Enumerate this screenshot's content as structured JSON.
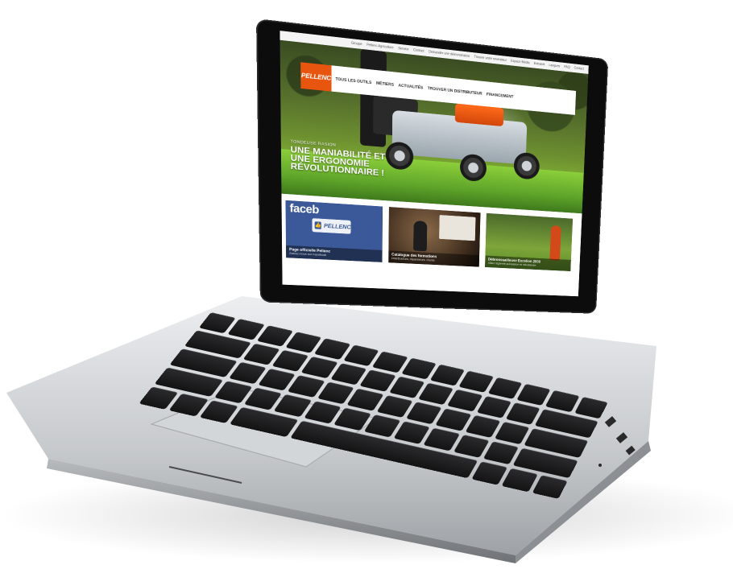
{
  "util_nav": {
    "items": [
      "Groupe",
      "Pellenc Agriculture",
      "Service",
      "Contact",
      "Demander une démonstration",
      "Trouver votre revendeur",
      "Espace Media",
      "Extranet",
      "Langues",
      "FAQ",
      "Contact"
    ]
  },
  "logo": {
    "text": "PELLENC"
  },
  "main_nav": {
    "items": [
      "TOUS LES OUTILS",
      "MÉTIERS",
      "ACTUALITÉS",
      "TROUVER UN DISTRIBUTEUR",
      "FINANCEMENT"
    ]
  },
  "hero": {
    "kicker": "TONDEUSE RASION",
    "headline": "UNE MANIABILITÉ ET UNE ERGONOMIE RÉVOLUTIONNAIRE !"
  },
  "tiles": [
    {
      "title": "Page officielle Pellenc",
      "subtitle": "Suivez-nous sur Facebook",
      "badge_word": "faceb",
      "like_logo": "PELLENC",
      "thumb_icon": "thumbs-up-icon"
    },
    {
      "title": "Catalogue des formations",
      "subtitle": "Distributeurs, réparateurs, clients",
      "thumb_icon": "training-photo"
    },
    {
      "title": "Débroussailleuse Excelion 2000",
      "subtitle": "Alliez légèreté puissance et robustesse",
      "thumb_icon": "brushcutter-photo"
    }
  ],
  "colors": {
    "brand_orange": "#e8550f",
    "facebook_blue": "#3b5998",
    "laptop_silver": "#c9cbce"
  }
}
